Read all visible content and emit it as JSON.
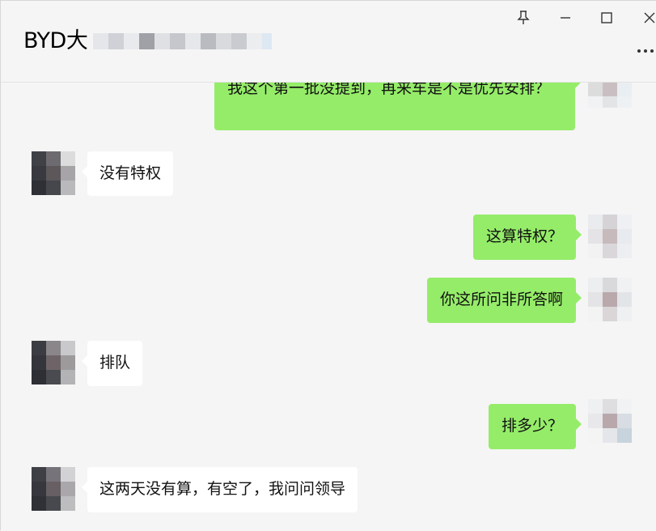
{
  "header": {
    "title": "BYD大",
    "controls": {
      "pin_icon": "pin-icon",
      "minimize_icon": "minimize-icon",
      "maximize_icon": "maximize-icon",
      "close_icon": "close-icon",
      "more_icon": "more-icon"
    }
  },
  "messages": [
    {
      "side": "out",
      "text": "我这个第一批没提到，再来车是不是优先安排？"
    },
    {
      "side": "in",
      "text": "没有特权"
    },
    {
      "side": "out",
      "text": "这算特权？"
    },
    {
      "side": "out",
      "text": "你这所问非所答啊"
    },
    {
      "side": "in",
      "text": "排队"
    },
    {
      "side": "out",
      "text": "排多少？"
    },
    {
      "side": "in",
      "text": "这两天没有算，有空了，我问问领导"
    }
  ],
  "colors": {
    "background": "#f5f5f5",
    "bubble_out": "#95ec69",
    "bubble_in": "#ffffff",
    "text": "#111111"
  }
}
